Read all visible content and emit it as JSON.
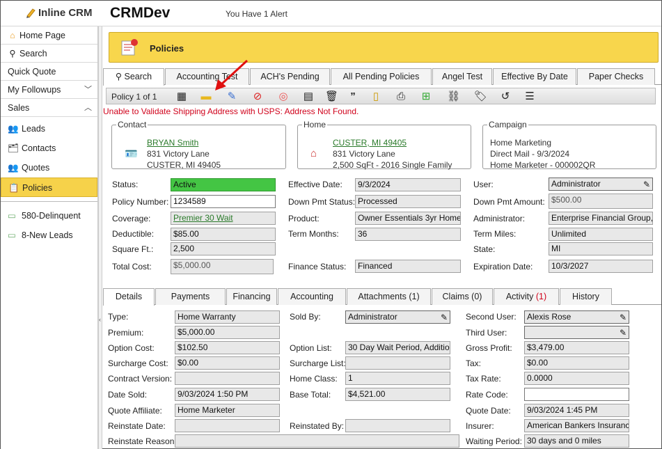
{
  "app": {
    "logo": "Inline CRM",
    "title": "CRMDev",
    "alert": "You Have 1 Alert"
  },
  "sidebar": {
    "items": [
      {
        "label": "Home Page",
        "icon": "home-icon"
      },
      {
        "label": "Search",
        "icon": "search-icon"
      },
      {
        "label": "Quick Quote"
      },
      {
        "label": "My Followups"
      },
      {
        "label": "Sales"
      }
    ],
    "sub": [
      {
        "label": "Leads",
        "icon": "leads-icon"
      },
      {
        "label": "Contacts",
        "icon": "contacts-icon"
      },
      {
        "label": "Quotes",
        "icon": "quotes-icon"
      },
      {
        "label": "Policies",
        "icon": "policies-icon"
      }
    ],
    "queues": [
      {
        "label": "580-Delinquent"
      },
      {
        "label": "8-New Leads"
      }
    ]
  },
  "banner": {
    "title": "Policies"
  },
  "tabs": [
    "Search",
    "Accounting Test",
    "ACH's Pending",
    "All Pending Policies",
    "Angel Test",
    "Effective By Date",
    "Paper Checks"
  ],
  "toolbar": {
    "pager": "Policy 1 of 1"
  },
  "warning": "Unable to Validate Shipping Address with USPS: Address Not Found.",
  "contact": {
    "legend": "Contact",
    "name": "BRYAN Smith",
    "street": "831 Victory Lane",
    "city": "CUSTER, MI 49405"
  },
  "home": {
    "legend": "Home",
    "city_link": "CUSTER, MI 49405",
    "street": "831 Victory Lane",
    "details": "2,500 SqFt - 2016 Single Family"
  },
  "campaign": {
    "legend": "Campaign",
    "line1": "Home Marketing",
    "line2": "Direct Mail - 9/3/2024",
    "line3": "Home Marketer - 000002QR"
  },
  "policy": {
    "status_label": "Status:",
    "status": "Active",
    "number_label": "Policy Number:",
    "number": "1234589",
    "coverage_label": "Coverage:",
    "coverage": "Premier 30 Wait",
    "deductible_label": "Deductible:",
    "deductible": "$85.00",
    "sqft_label": "Square Ft.:",
    "sqft": "2,500",
    "total_label": "Total Cost:",
    "total": "$5,000.00",
    "eff_label": "Effective Date:",
    "eff": "9/3/2024",
    "dps_label": "Down Pmt Status:",
    "dps": "Processed",
    "product_label": "Product:",
    "product": "Owner Essentials 3yr Home",
    "term_label": "Term Months:",
    "term": "36",
    "fin_label": "Finance Status:",
    "fin": "Financed",
    "user_label": "User:",
    "user": "Administrator",
    "dpa_label": "Down Pmt Amount:",
    "dpa": "$500.00",
    "admin_label": "Administrator:",
    "admin": "Enterprise Financial Group,",
    "miles_label": "Term Miles:",
    "miles": "Unlimited",
    "state_label": "State:",
    "state": "MI",
    "exp_label": "Expiration Date:",
    "exp": "10/3/2027"
  },
  "detail_tabs": [
    {
      "label": "Details"
    },
    {
      "label": "Payments"
    },
    {
      "label": "Financing"
    },
    {
      "label": "Accounting"
    },
    {
      "label": "Attachments (1)"
    },
    {
      "label": "Claims (0)"
    },
    {
      "label": "Activity",
      "count": "(1)"
    },
    {
      "label": "History"
    }
  ],
  "details": {
    "type_label": "Type:",
    "type": "Home Warranty",
    "premium_label": "Premium:",
    "premium": "$5,000.00",
    "opt_cost_label": "Option Cost:",
    "opt_cost": "$102.50",
    "sur_cost_label": "Surcharge Cost:",
    "sur_cost": "$0.00",
    "cv_label": "Contract Version:",
    "cv": "",
    "sold_date_label": "Date Sold:",
    "sold_date": "9/03/2024 1:50 PM",
    "qa_label": "Quote Affiliate:",
    "qa": "Home Marketer",
    "rd_label": "Reinstate Date:",
    "rd": "",
    "rr_label": "Reinstate Reason:",
    "rr": "",
    "sold_by_label": "Sold By:",
    "sold_by": "Administrator",
    "opt_list_label": "Option List:",
    "opt_list": "30 Day Wait Period, Additio",
    "sur_list_label": "Surcharge List:",
    "sur_list": "",
    "hc_label": "Home Class:",
    "hc": "1",
    "base_label": "Base Total:",
    "base": "$4,521.00",
    "rb_label": "Reinstated By:",
    "rb": "",
    "su_label": "Second User:",
    "su": "Alexis Rose",
    "tu_label": "Third User:",
    "tu": "",
    "gp_label": "Gross Profit:",
    "gp": "$3,479.00",
    "tax_label": "Tax:",
    "tax": "$0.00",
    "tr_label": "Tax Rate:",
    "tr": "0.0000",
    "rc_label": "Rate Code:",
    "rc": "",
    "qd_label": "Quote Date:",
    "qd": "9/03/2024 1:45 PM",
    "ins_label": "Insurer:",
    "ins": "American Bankers Insuranc",
    "wp_label": "Waiting Period:",
    "wp": "30 days and 0 miles"
  }
}
